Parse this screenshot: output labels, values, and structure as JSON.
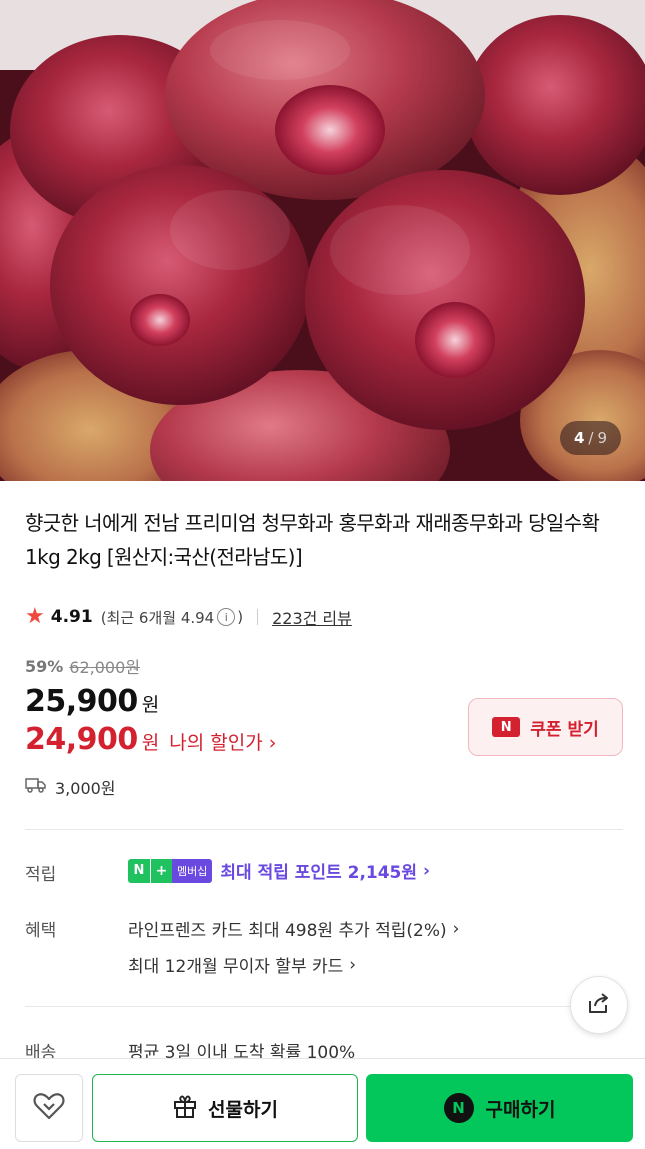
{
  "gallery": {
    "current": "4",
    "separator": "/",
    "total": "9"
  },
  "product": {
    "title": "향긋한 너에게 전남 프리미엄 청무화과 홍무화과 재래종무화과 당일수확 1kg 2kg [원산지:국산(전라남도)]"
  },
  "rating": {
    "star": "★",
    "score": "4.91",
    "recent_prefix": "(최근 6개월 4.94",
    "info_glyph": "i",
    "recent_suffix": ")",
    "review_count": "223건 리뷰"
  },
  "price": {
    "discount_rate": "59%",
    "original": "62,000원",
    "sale": "25,900",
    "sale_unit": "원",
    "my_price": "24,900",
    "my_unit": "원",
    "my_label": "나의 할인가",
    "my_chevron": "›"
  },
  "coupon": {
    "icon": "N",
    "label": "쿠폰 받기"
  },
  "shipping": {
    "fee": "3,000원"
  },
  "points": {
    "label": "적립",
    "badge_n": "N",
    "badge_plus": "+",
    "badge_member": "멤버십",
    "text": "최대 적립 포인트 2,145원",
    "chevron": "›"
  },
  "benefits": {
    "label": "혜택",
    "line1": "라인프렌즈 카드 최대 498원 추가 적립(2%)",
    "line2": "최대 12개월 무이자 할부 카드",
    "chevron": "›"
  },
  "delivery": {
    "label": "배송",
    "text": "평균 3일 이내 도착 확률 100%"
  },
  "bottom_bar": {
    "gift_label": "선물하기",
    "buy_icon": "N",
    "buy_label": "구매하기"
  },
  "colors": {
    "accent_red": "#d3212f",
    "naver_green": "#03c75a",
    "membership_purple": "#6a49e0",
    "star": "#f04a3e"
  },
  "icons": {
    "wish": "heart-icon",
    "gift": "gift-icon",
    "share": "share-icon",
    "truck": "truck-icon",
    "info": "info-icon"
  }
}
